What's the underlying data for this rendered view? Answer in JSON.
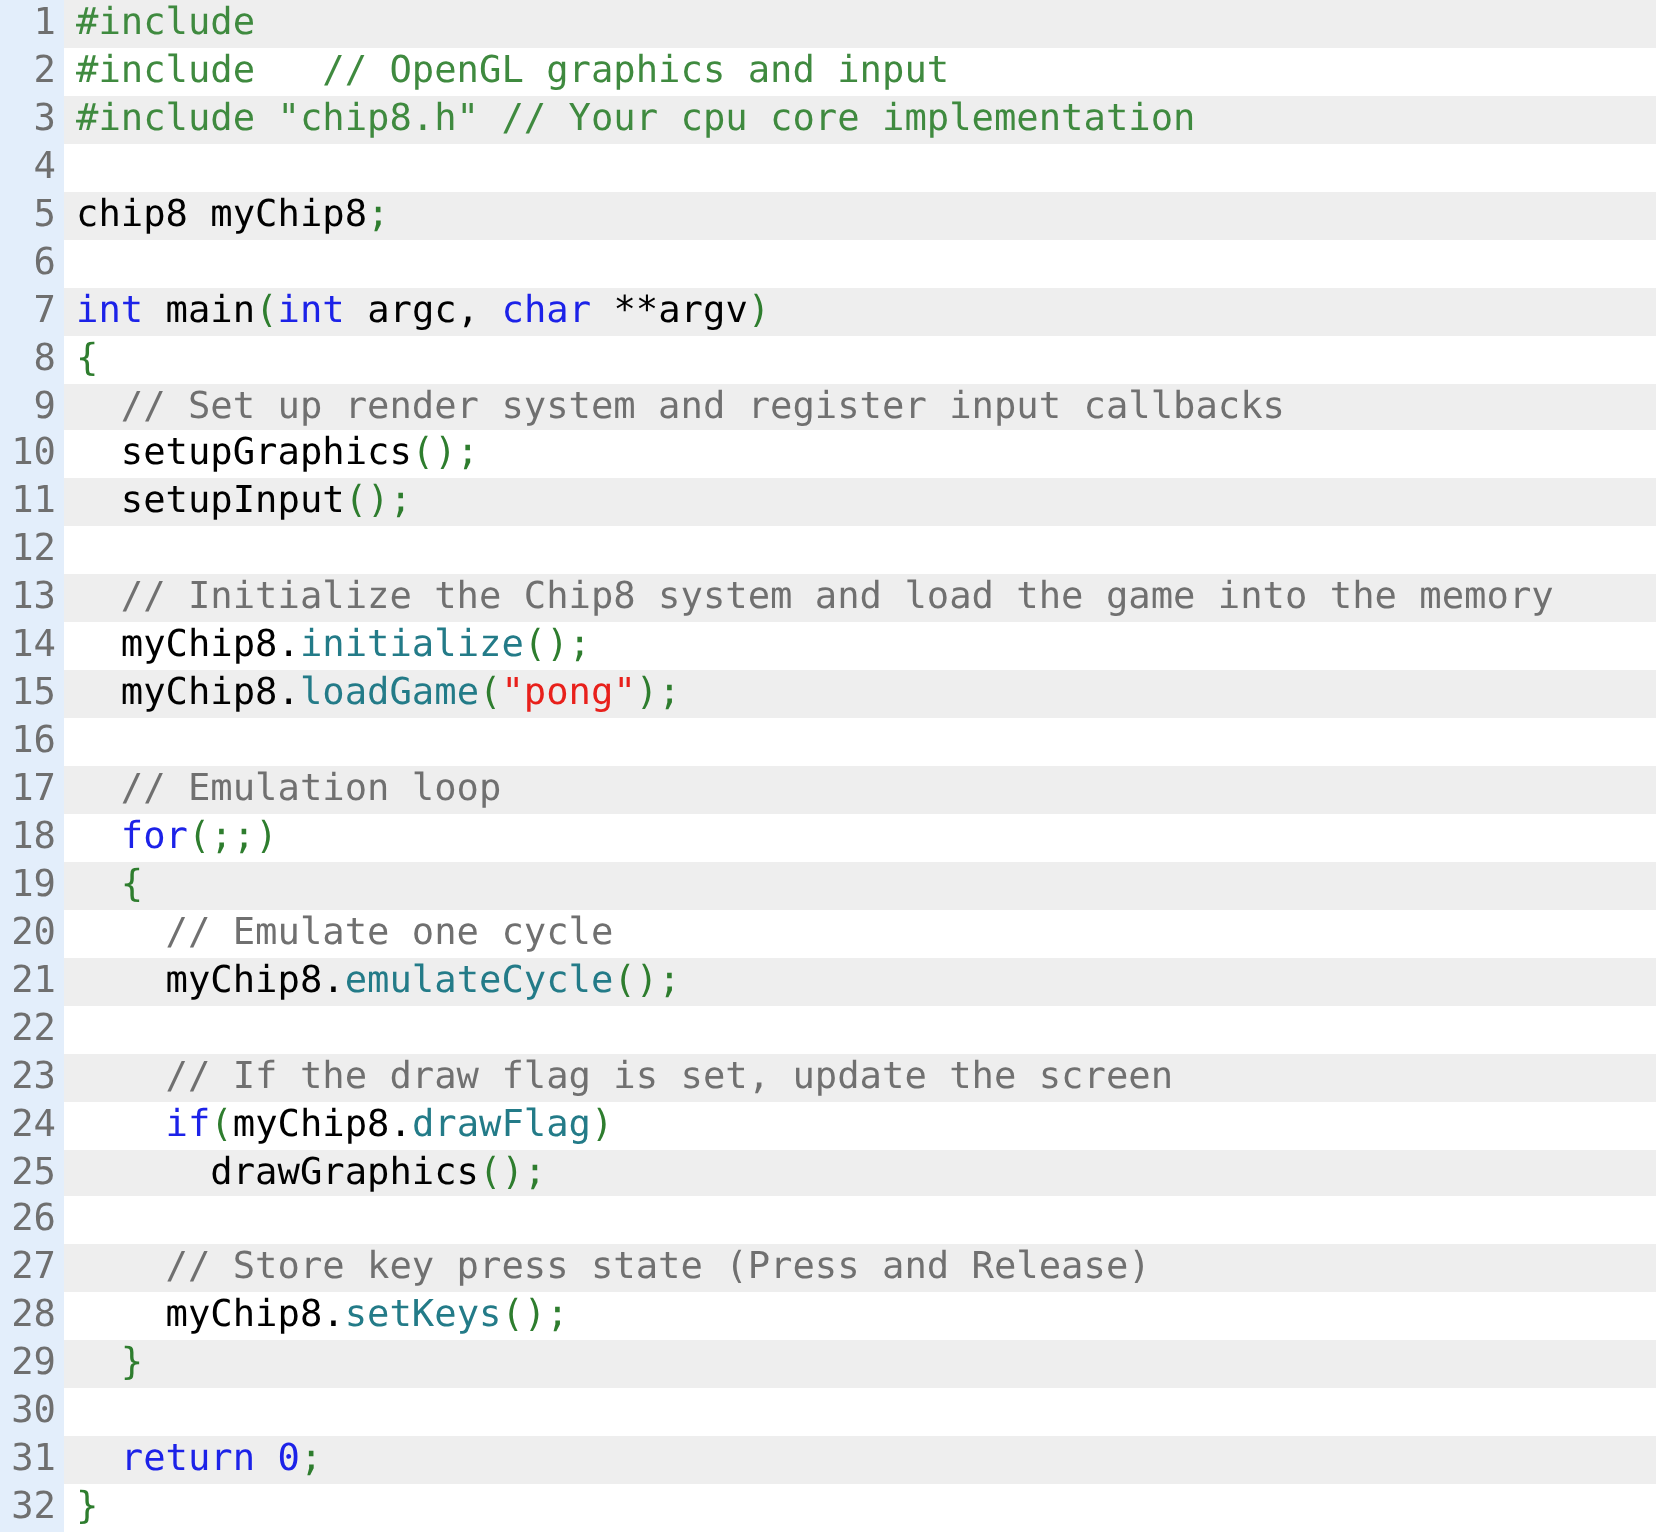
{
  "code_lines": [
    {
      "number": "1",
      "segments": [
        {
          "kind": "preproc",
          "text": "#include"
        }
      ]
    },
    {
      "number": "2",
      "segments": [
        {
          "kind": "preproc",
          "text": "#include   // OpenGL graphics and input"
        }
      ]
    },
    {
      "number": "3",
      "segments": [
        {
          "kind": "preproc",
          "text": "#include \"chip8.h\" // Your cpu core implementation"
        }
      ]
    },
    {
      "number": "4"
    },
    {
      "number": "5",
      "segments": [
        {
          "kind": "plain",
          "text": "chip8 myChip8"
        },
        {
          "kind": "punct",
          "text": ";"
        }
      ]
    },
    {
      "number": "6"
    },
    {
      "number": "7",
      "segments": [
        {
          "kind": "keyword",
          "text": "int"
        },
        {
          "kind": "plain",
          "text": " main"
        },
        {
          "kind": "punct",
          "text": "("
        },
        {
          "kind": "keyword",
          "text": "int"
        },
        {
          "kind": "plain",
          "text": " argc, "
        },
        {
          "kind": "keyword",
          "text": "char"
        },
        {
          "kind": "plain",
          "text": " **argv"
        },
        {
          "kind": "punct",
          "text": ")"
        }
      ]
    },
    {
      "number": "8",
      "segments": [
        {
          "kind": "punct",
          "text": "{"
        }
      ]
    },
    {
      "number": "9",
      "segments": [
        {
          "kind": "comment",
          "text": "  // Set up render system and register input callbacks"
        }
      ]
    },
    {
      "number": "10",
      "segments": [
        {
          "kind": "plain",
          "text": "  setupGraphics"
        },
        {
          "kind": "punct",
          "text": "();"
        }
      ]
    },
    {
      "number": "11",
      "segments": [
        {
          "kind": "plain",
          "text": "  setupInput"
        },
        {
          "kind": "punct",
          "text": "();"
        }
      ]
    },
    {
      "number": "12"
    },
    {
      "number": "13",
      "segments": [
        {
          "kind": "comment",
          "text": "  // Initialize the Chip8 system and load the game into the memory"
        }
      ]
    },
    {
      "number": "14",
      "segments": [
        {
          "kind": "plain",
          "text": "  myChip8."
        },
        {
          "kind": "method",
          "text": "initialize"
        },
        {
          "kind": "punct",
          "text": "();"
        }
      ]
    },
    {
      "number": "15",
      "segments": [
        {
          "kind": "plain",
          "text": "  myChip8."
        },
        {
          "kind": "method",
          "text": "loadGame"
        },
        {
          "kind": "punct",
          "text": "("
        },
        {
          "kind": "string",
          "text": "\"pong\""
        },
        {
          "kind": "punct",
          "text": ");"
        }
      ]
    },
    {
      "number": "16"
    },
    {
      "number": "17",
      "segments": [
        {
          "kind": "comment",
          "text": "  // Emulation loop"
        }
      ]
    },
    {
      "number": "18",
      "segments": [
        {
          "kind": "keyword",
          "text": "  for"
        },
        {
          "kind": "punct",
          "text": "(;;)"
        }
      ]
    },
    {
      "number": "19",
      "segments": [
        {
          "kind": "punct",
          "text": "  {"
        }
      ]
    },
    {
      "number": "20",
      "segments": [
        {
          "kind": "comment",
          "text": "    // Emulate one cycle"
        }
      ]
    },
    {
      "number": "21",
      "segments": [
        {
          "kind": "plain",
          "text": "    myChip8."
        },
        {
          "kind": "method",
          "text": "emulateCycle"
        },
        {
          "kind": "punct",
          "text": "();"
        }
      ]
    },
    {
      "number": "22"
    },
    {
      "number": "23",
      "segments": [
        {
          "kind": "comment",
          "text": "    // If the draw flag is set, update the screen"
        }
      ]
    },
    {
      "number": "24",
      "segments": [
        {
          "kind": "keyword",
          "text": "    if"
        },
        {
          "kind": "punct",
          "text": "("
        },
        {
          "kind": "plain",
          "text": "myChip8."
        },
        {
          "kind": "method",
          "text": "drawFlag"
        },
        {
          "kind": "punct",
          "text": ")"
        }
      ]
    },
    {
      "number": "25",
      "segments": [
        {
          "kind": "plain",
          "text": "      drawGraphics"
        },
        {
          "kind": "punct",
          "text": "();"
        }
      ]
    },
    {
      "number": "26"
    },
    {
      "number": "27",
      "segments": [
        {
          "kind": "comment",
          "text": "    // Store key press state (Press and Release)"
        }
      ]
    },
    {
      "number": "28",
      "segments": [
        {
          "kind": "plain",
          "text": "    myChip8."
        },
        {
          "kind": "method",
          "text": "setKeys"
        },
        {
          "kind": "punct",
          "text": "();"
        }
      ]
    },
    {
      "number": "29",
      "segments": [
        {
          "kind": "punct",
          "text": "  }"
        }
      ]
    },
    {
      "number": "30"
    },
    {
      "number": "31",
      "segments": [
        {
          "kind": "keyword",
          "text": "  return "
        },
        {
          "kind": "number",
          "text": "0"
        },
        {
          "kind": "punct",
          "text": ";"
        }
      ]
    },
    {
      "number": "32",
      "segments": [
        {
          "kind": "punct",
          "text": "}"
        }
      ]
    }
  ]
}
